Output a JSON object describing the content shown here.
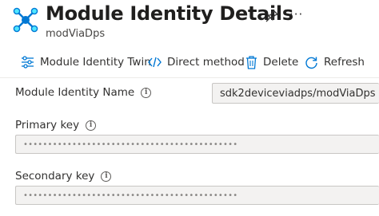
{
  "header": {
    "title": "Module Identity Details",
    "subtitle": "modViaDps",
    "more": "···"
  },
  "toolbar": {
    "module_twin": "Module Identity Twin",
    "direct_method": "Direct method",
    "delete": "Delete",
    "refresh": "Refresh"
  },
  "form": {
    "name_label": "Module Identity Name",
    "name_value": "sdk2deviceviadps/modViaDps",
    "primary_label": "Primary key",
    "primary_value": "••••••••••••••••••••••••••••••••••••••••••••",
    "secondary_label": "Secondary key",
    "secondary_value": "••••••••••••••••••••••••••••••••••••••••••••",
    "info": "i"
  },
  "colors": {
    "accent": "#0078d4",
    "field_bg": "#f3f2f1"
  }
}
